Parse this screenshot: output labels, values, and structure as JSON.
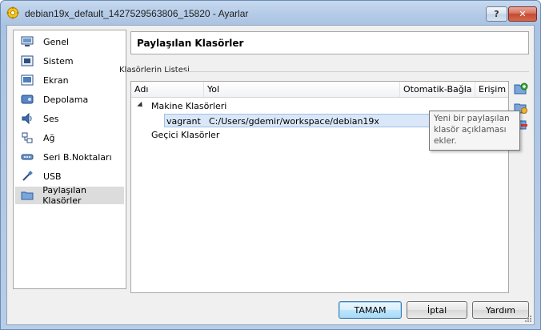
{
  "window": {
    "title": "debian19x_default_1427529563806_15820 - Ayarlar",
    "help_label": "?",
    "close_label": "✕"
  },
  "sidebar": {
    "items": [
      {
        "label": "Genel",
        "icon": "monitor-icon"
      },
      {
        "label": "Sistem",
        "icon": "chip-icon"
      },
      {
        "label": "Ekran",
        "icon": "display-icon"
      },
      {
        "label": "Depolama",
        "icon": "storage-icon"
      },
      {
        "label": "Ses",
        "icon": "speaker-icon"
      },
      {
        "label": "Ağ",
        "icon": "network-icon"
      },
      {
        "label": "Seri B.Noktaları",
        "icon": "serial-port-icon"
      },
      {
        "label": "USB",
        "icon": "usb-icon"
      },
      {
        "label": "Paylaşılan Klasörler",
        "icon": "shared-folder-icon",
        "selected": true
      }
    ]
  },
  "main": {
    "title": "Paylaşılan Klasörler",
    "group_label": "Klasörlerin Listesi",
    "columns": [
      "Adı",
      "Yol",
      "Otomatik-Bağla",
      "Erişim"
    ],
    "tree": {
      "machine_group": "Makine Klasörleri",
      "share_name": "vagrant",
      "share_path": "C:/Users/gdemir/workspace/debian19x",
      "temp_group": "Geçici Klasörler"
    },
    "tooltip": [
      "Yeni bir paylaşılan",
      "klasör açıklaması",
      "ekler."
    ]
  },
  "buttons": {
    "ok": "TAMAM",
    "cancel": "İptal",
    "help": "Yardım"
  }
}
